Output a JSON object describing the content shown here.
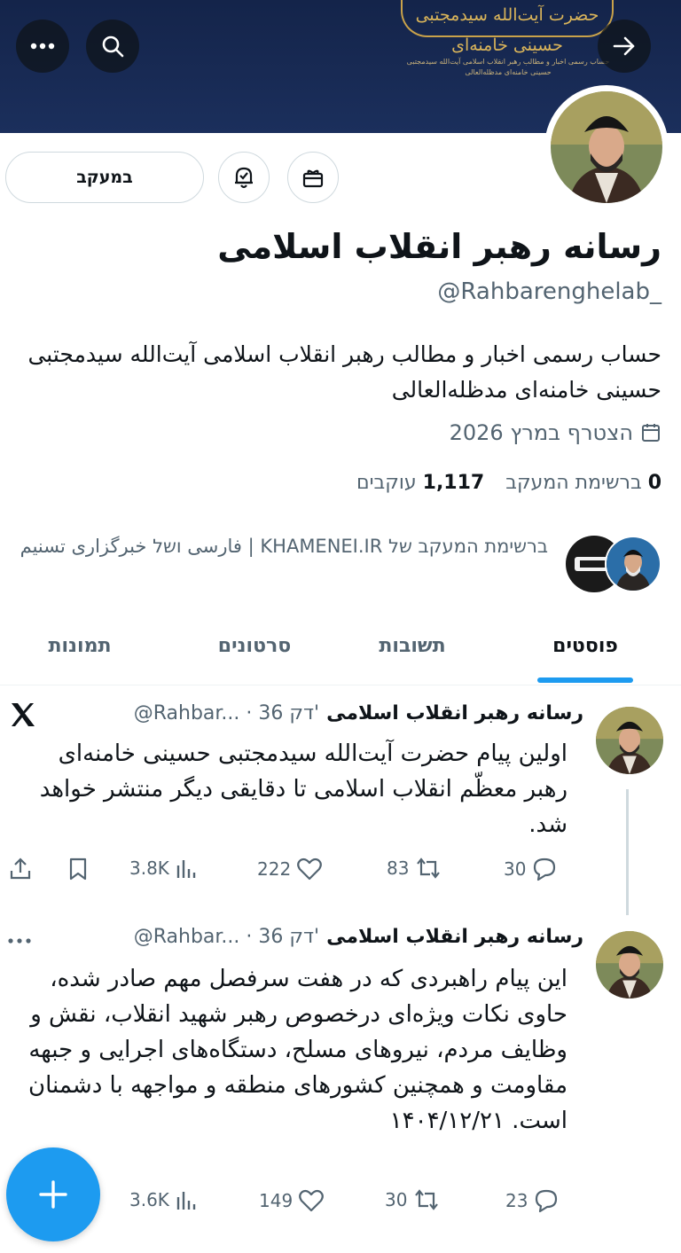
{
  "banner": {
    "emblem_text": "حضرت آیت‌الله سیدمجتبی حسینی خامنه‌ای",
    "sub_text": "حساب رسمی اخبار و مطالب رهبر انقلاب اسلامی آیت‌الله سیدمجتبی حسینی خامنه‌ای مدظله‌العالی"
  },
  "profile": {
    "display_name": "رسانه رهبر انقلاب اسلامی",
    "handle": "@Rahbarenghelab_",
    "bio": "حساب رسمی اخبار و مطالب رهبر انقلاب اسلامی آیت‌الله سیدمجتبی حسینی خامنه‌ای مدظله‌العالی",
    "joined": "הצטרף במרץ 2026",
    "following_count": "0",
    "following_label": "ברשימת המעקב",
    "followers_count": "1,117",
    "followers_label": "עוקבים",
    "followed_by": "ברשימת המעקב של KHAMENEI.IR | فارسی ושל خبرگزاری تسنیم",
    "follow_button": "במעקב"
  },
  "tabs": [
    "פוסטים",
    "תשובות",
    "סרטונים",
    "תמונות"
  ],
  "posts": [
    {
      "name": "رسانه رهبر انقلاب اسلامی",
      "meta": "@Rahbar... · 36 דק'",
      "text": "اولین پیام حضرت آیت‌الله سیدمجتبی حسینی خامنه‌ای رهبر معظّم انقلاب اسلامی تا دقایقی دیگر منتشر خواهد شد.",
      "replies": "30",
      "reposts": "83",
      "likes": "222",
      "views": "3.8K"
    },
    {
      "name": "رسانه رهبر انقلاب اسلامی",
      "meta": "@Rahbar... · 36 דק'",
      "text": "این پیام راهبردی که در هفت سرفصل مهم صادر شده، حاوی نکات ویژه‌ای درخصوص رهبر شهید انقلاب، نقش و وظایف مردم، نیروهای مسلح، دستگاه‌های اجرایی و جبهه مقاومت و همچنین کشورهای منطقه و مواجهه با دشمنان است. ۱۴۰۴/۱۲/۲۱",
      "replies": "23",
      "reposts": "30",
      "likes": "149",
      "views": "3.6K"
    }
  ],
  "colors": {
    "accent": "#1d9bf0",
    "banner": "#14244a",
    "muted": "#536471"
  }
}
